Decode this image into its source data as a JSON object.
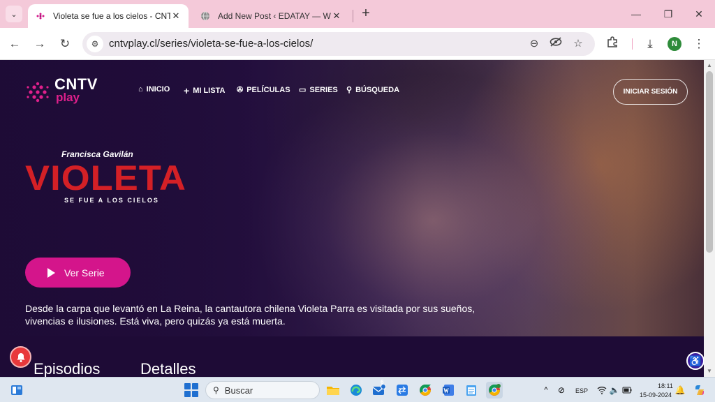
{
  "browser": {
    "tabs": [
      {
        "title": "Violeta se fue a los cielos - CNTV P",
        "active": true
      },
      {
        "title": "Add New Post ‹ EDATAY — WordPr",
        "active": false
      }
    ],
    "url": "cntvplay.cl/series/violeta-se-fue-a-los-cielos/",
    "profile_initial": "N"
  },
  "site": {
    "logo": {
      "top": "CNTV",
      "bottom": "play"
    },
    "nav": [
      {
        "label": "INICIO",
        "icon": "home-icon",
        "glyph": "⌂"
      },
      {
        "label": "MI LISTA",
        "icon": "plus-icon",
        "glyph": "+"
      },
      {
        "label": "PELÍCULAS",
        "icon": "film-reel-icon",
        "glyph": "✇"
      },
      {
        "label": "SERIES",
        "icon": "tv-icon",
        "glyph": "▭"
      },
      {
        "label": "BÚSQUEDA",
        "icon": "search-icon",
        "glyph": "⚲"
      }
    ],
    "login_label": "INICIAR SESIÓN",
    "hero": {
      "actor": "Francisca Gavilán",
      "title": "VIOLETA",
      "subtitle": "SE FUE A LOS CIELOS",
      "play_label": "Ver Serie",
      "synopsis": "Desde la carpa que levantó en La Reina, la cantautora chilena Violeta Parra es visitada por sus sueños, vivencias e ilusiones. Está viva, pero quizás ya está muerta."
    },
    "sections": [
      "Episodios",
      "Detalles"
    ],
    "colors": {
      "accent": "#d4158b",
      "title_red": "#d42026",
      "background": "#1e0b36"
    }
  },
  "taskbar": {
    "search_placeholder": "Buscar",
    "mail_badge": "6",
    "language": "ESP",
    "time": "18:11",
    "date": "15-09-2024"
  }
}
